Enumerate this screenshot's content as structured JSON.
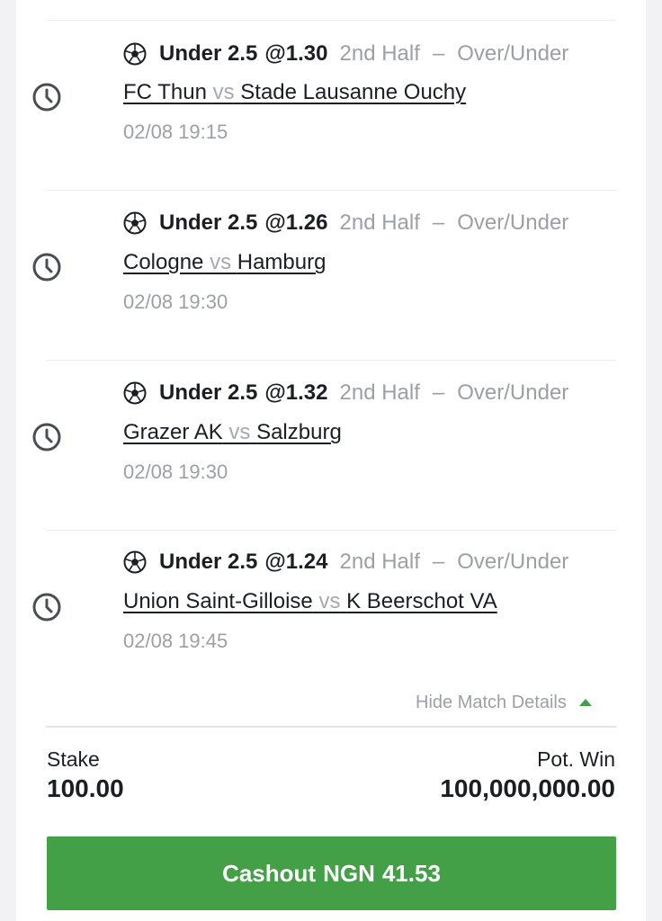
{
  "bets": [
    {
      "selection": "Under 2.5",
      "odds": "@1.30",
      "market_period": "2nd Half",
      "market_type": "Over/Under",
      "home": "FC Thun",
      "vs": "vs",
      "away": "Stade Lausanne Ouchy",
      "kickoff": "02/08 19:15"
    },
    {
      "selection": "Under 2.5",
      "odds": "@1.26",
      "market_period": "2nd Half",
      "market_type": "Over/Under",
      "home": "Cologne",
      "vs": "vs",
      "away": "Hamburg",
      "kickoff": "02/08 19:30"
    },
    {
      "selection": "Under 2.5",
      "odds": "@1.32",
      "market_period": "2nd Half",
      "market_type": "Over/Under",
      "home": "Grazer AK",
      "vs": "vs",
      "away": "Salzburg",
      "kickoff": "02/08 19:30"
    },
    {
      "selection": "Under 2.5",
      "odds": "@1.24",
      "market_period": "2nd Half",
      "market_type": "Over/Under",
      "home": "Union Saint-Gilloise",
      "vs": "vs",
      "away": "K Beerschot VA",
      "kickoff": "02/08 19:45"
    }
  ],
  "separator": "–",
  "toggle": {
    "label": "Hide Match Details",
    "icon": "caret-up-icon"
  },
  "stake": {
    "label": "Stake",
    "value": "100.00"
  },
  "pot_win": {
    "label": "Pot. Win",
    "value": "100,000,000.00"
  },
  "cashout": {
    "label": "Cashout",
    "currency": "NGN",
    "amount": "41.53"
  },
  "colors": {
    "accent_green": "#43a047",
    "primary_text": "#1b1e24",
    "muted_text": "#9ca0a6"
  },
  "icons": {
    "status": "clock-icon",
    "sport": "soccer-ball-icon"
  }
}
